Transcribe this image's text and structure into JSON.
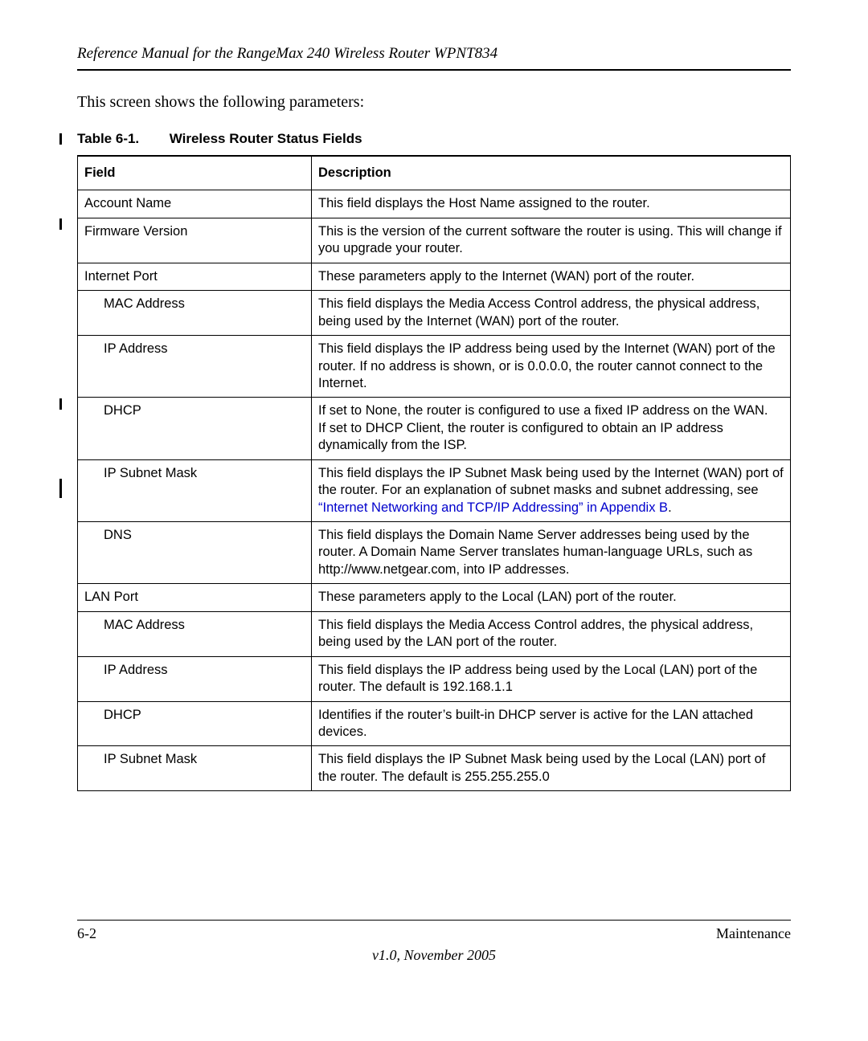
{
  "header": "Reference Manual for the RangeMax 240 Wireless Router WPNT834",
  "intro": "This screen shows the following parameters:",
  "table": {
    "caption_number": "Table 6-1.",
    "caption_title": "Wireless Router Status Fields",
    "head_field": "Field",
    "head_desc": "Description",
    "rows": [
      {
        "field": "Account Name",
        "indent": 0,
        "desc": "This field displays the Host Name assigned to the router."
      },
      {
        "field": "Firmware Version",
        "indent": 0,
        "desc": "This is the version of the current software the router is using. This will change if you upgrade your router."
      },
      {
        "field": "Internet Port",
        "indent": 0,
        "desc": "These parameters apply to the Internet (WAN) port of the router."
      },
      {
        "field": "MAC Address",
        "indent": 1,
        "desc": "This field displays the Media Access Control address, the physical address, being used by the Internet (WAN) port of the router."
      },
      {
        "field": "IP Address",
        "indent": 1,
        "desc": "This field displays the IP address being used by the Internet (WAN) port of the router. If no address is shown, or is 0.0.0.0, the router cannot connect to the Internet."
      },
      {
        "field": "DHCP",
        "indent": 1,
        "desc": "If set to None, the router is configured to use a fixed IP address on the WAN.\nIf set to DHCP Client, the router is configured to obtain an IP address dynamically from the ISP."
      },
      {
        "field": "IP Subnet Mask",
        "indent": 1,
        "desc_pre": "This field displays the IP Subnet Mask being used by the Internet (WAN) port of the router. For an explanation of subnet masks and subnet addressing, see ",
        "desc_link": "“Internet Networking and TCP/IP Addressing” in Appendix B",
        "desc_post": "."
      },
      {
        "field": "DNS",
        "indent": 1,
        "desc": "This field displays the Domain Name Server addresses being used by the router. A Domain Name Server translates human-language URLs, such as http://www.netgear.com, into IP addresses."
      },
      {
        "field": "LAN Port",
        "indent": 0,
        "desc": "These parameters apply to the Local (LAN) port of the router."
      },
      {
        "field": "MAC Address",
        "indent": 1,
        "desc": "This field displays the Media Access Control addres, the physical address, being used by the LAN port of the router."
      },
      {
        "field": "IP Address",
        "indent": 1,
        "desc": "This field displays the IP address being used by the Local (LAN) port of the router. The default is 192.168.1.1"
      },
      {
        "field": "DHCP",
        "indent": 1,
        "desc": "Identifies if the router’s built-in DHCP server is active for the LAN attached devices."
      },
      {
        "field": "IP Subnet Mask",
        "indent": 1,
        "desc": "This field displays the IP Subnet Mask being used by the Local (LAN) port of the router. The default is 255.255.255.0"
      }
    ]
  },
  "footer": {
    "page_number": "6-2",
    "section": "Maintenance",
    "version": "v1.0, November 2005"
  }
}
